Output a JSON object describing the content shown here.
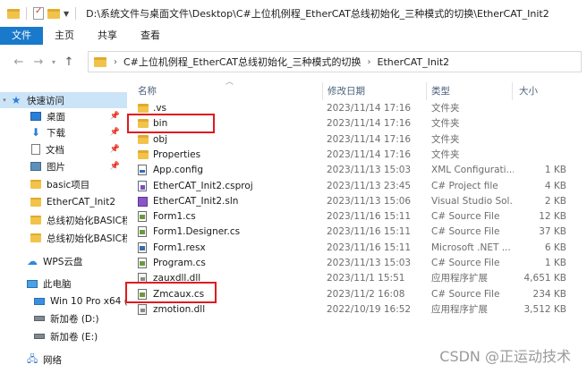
{
  "titlebar": {
    "path": "D:\\系统文件与桌面文件\\Desktop\\C#上位机例程_EtherCAT总线初始化_三种模式的切换\\EtherCAT_Init2"
  },
  "ribbon": {
    "tabs": [
      "文件",
      "主页",
      "共享",
      "查看"
    ]
  },
  "address": {
    "crumbs": [
      "C#上位机例程_EtherCAT总线初始化_三种模式的切换",
      "EtherCAT_Init2"
    ]
  },
  "sidebar": {
    "quick_access": "快速访问",
    "items": [
      {
        "label": "桌面",
        "icon": "desktop-icon",
        "pinned": true
      },
      {
        "label": "下载",
        "icon": "download-icon",
        "pinned": true
      },
      {
        "label": "文档",
        "icon": "document-icon",
        "pinned": true
      },
      {
        "label": "图片",
        "icon": "picture-icon",
        "pinned": true
      },
      {
        "label": "basic项目",
        "icon": "folder-icon",
        "pinned": false
      },
      {
        "label": "EtherCAT_Init2",
        "icon": "folder-icon",
        "pinned": false
      },
      {
        "label": "总线初始化BASIC程",
        "icon": "folder-icon",
        "pinned": false
      },
      {
        "label": "总线初始化BASIC程",
        "icon": "folder-icon",
        "pinned": false
      }
    ],
    "wps_cloud": "WPS云盘",
    "this_pc": "此电脑",
    "drives": [
      "Win 10 Pro x64 (C",
      "新加卷 (D:)",
      "新加卷 (E:)"
    ],
    "network": "网络"
  },
  "columns": {
    "name": "名称",
    "date": "修改日期",
    "type": "类型",
    "size": "大小"
  },
  "files": [
    {
      "name": ".vs",
      "date": "2023/11/14 17:16",
      "type": "文件夹",
      "size": "",
      "icon": "folder"
    },
    {
      "name": "bin",
      "date": "2023/11/14 17:16",
      "type": "文件夹",
      "size": "",
      "icon": "folder"
    },
    {
      "name": "obj",
      "date": "2023/11/14 17:16",
      "type": "文件夹",
      "size": "",
      "icon": "folder"
    },
    {
      "name": "Properties",
      "date": "2023/11/14 17:16",
      "type": "文件夹",
      "size": "",
      "icon": "folder"
    },
    {
      "name": "App.config",
      "date": "2023/11/13 15:03",
      "type": "XML Configurati...",
      "size": "1 KB",
      "icon": "xml"
    },
    {
      "name": "EtherCAT_Init2.csproj",
      "date": "2023/11/13 23:45",
      "type": "C# Project file",
      "size": "4 KB",
      "icon": "proj"
    },
    {
      "name": "EtherCAT_Init2.sln",
      "date": "2023/11/13 15:06",
      "type": "Visual Studio Sol...",
      "size": "2 KB",
      "icon": "sln"
    },
    {
      "name": "Form1.cs",
      "date": "2023/11/16 15:11",
      "type": "C# Source File",
      "size": "12 KB",
      "icon": "cs"
    },
    {
      "name": "Form1.Designer.cs",
      "date": "2023/11/16 15:11",
      "type": "C# Source File",
      "size": "37 KB",
      "icon": "cs"
    },
    {
      "name": "Form1.resx",
      "date": "2023/11/16 15:11",
      "type": "Microsoft .NET ...",
      "size": "6 KB",
      "icon": "resx"
    },
    {
      "name": "Program.cs",
      "date": "2023/11/13 15:03",
      "type": "C# Source File",
      "size": "1 KB",
      "icon": "cs"
    },
    {
      "name": "zauxdll.dll",
      "date": "2023/11/1 15:51",
      "type": "应用程序扩展",
      "size": "4,651 KB",
      "icon": "dll"
    },
    {
      "name": "Zmcaux.cs",
      "date": "2023/11/2 16:08",
      "type": "C# Source File",
      "size": "234 KB",
      "icon": "cs"
    },
    {
      "name": "zmotion.dll",
      "date": "2022/10/19 16:52",
      "type": "应用程序扩展",
      "size": "3,512 KB",
      "icon": "dll"
    }
  ],
  "watermark": "CSDN @正运动技术",
  "colors": {
    "accent": "#1979ca",
    "highlight": "#e0191f",
    "selected": "#cce4f7"
  }
}
